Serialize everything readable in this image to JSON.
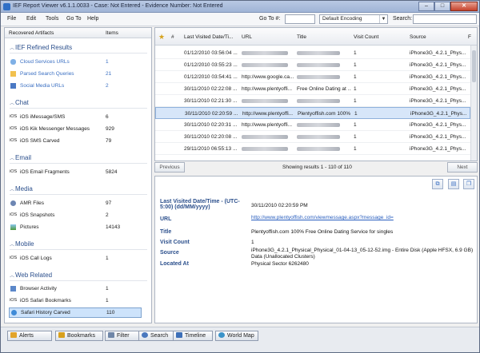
{
  "window": {
    "title": "IEF Report Viewer v6.1.1.0033 - Case: Not Entered - Evidence Number: Not Entered",
    "minimize": "–",
    "maximize": "□",
    "close": "✕"
  },
  "menubar": {
    "items": [
      "File",
      "Edit",
      "Tools",
      "Go To",
      "Help"
    ],
    "goto_label": "Go To #:",
    "goto_value": "",
    "encoding_value": "Default Encoding",
    "search_label": "Search:",
    "search_value": ""
  },
  "left_panel": {
    "header_artifacts": "Recovered Artifacts",
    "header_items": "Items",
    "sections": [
      {
        "title": "IEF Refined Results",
        "items": [
          {
            "label": "Cloud Services URLs",
            "count": "1",
            "icon": "cloud-icon",
            "link": true
          },
          {
            "label": "Parsed Search Queries",
            "count": "21",
            "icon": "search-query-icon",
            "link": true
          },
          {
            "label": "Social Media URLs",
            "count": "2",
            "icon": "social-icon",
            "link": true
          }
        ]
      },
      {
        "title": "Chat",
        "items": [
          {
            "label": "iOS iMessage/SMS",
            "count": "6",
            "icon": "ios-icon",
            "link": false
          },
          {
            "label": "iOS Kik Messenger Messages",
            "count": "929",
            "icon": "ios-icon",
            "link": false
          },
          {
            "label": "iOS SMS Carved",
            "count": "79",
            "icon": "ios-icon",
            "link": false
          }
        ]
      },
      {
        "title": "Email",
        "items": [
          {
            "label": "iOS Email Fragments",
            "count": "5824",
            "icon": "ios-icon",
            "link": false
          }
        ]
      },
      {
        "title": "Media",
        "items": [
          {
            "label": "AMR Files",
            "count": "97",
            "icon": "audio-icon",
            "link": false
          },
          {
            "label": "iOS Snapshots",
            "count": "2",
            "icon": "ios-icon",
            "link": false
          },
          {
            "label": "Pictures",
            "count": "14143",
            "icon": "picture-icon",
            "link": false
          }
        ]
      },
      {
        "title": "Mobile",
        "items": [
          {
            "label": "iOS Call Logs",
            "count": "1",
            "icon": "ios-icon",
            "link": false
          }
        ]
      },
      {
        "title": "Web Related",
        "items": [
          {
            "label": "Browser Activity",
            "count": "1",
            "icon": "browser-icon",
            "link": false
          },
          {
            "label": "iOS Safari Bookmarks",
            "count": "1",
            "icon": "ios-icon",
            "link": false
          },
          {
            "label": "Safari History Carved",
            "count": "110",
            "icon": "safari-icon",
            "link": false,
            "selected": true
          }
        ]
      }
    ]
  },
  "grid": {
    "headers": [
      "★",
      "#",
      "Last Visited Date/Ti...",
      "URL",
      "Title",
      "Visit Count",
      "Source"
    ],
    "rows": [
      {
        "date": "01/12/2010 03:56:04 ...",
        "url": "",
        "title": "",
        "visits": "1",
        "source": "iPhone3G_4.2.1_Phys..."
      },
      {
        "date": "01/12/2010 03:55:23 ...",
        "url": "",
        "title": "",
        "visits": "1",
        "source": "iPhone3G_4.2.1_Phys..."
      },
      {
        "date": "01/12/2010 03:54:41 ...",
        "url": "http://www.google.ca...",
        "title": "",
        "visits": "1",
        "source": "iPhone3G_4.2.1_Phys..."
      },
      {
        "date": "30/11/2010 02:22:08 ...",
        "url": "http://www.plentyoffi...",
        "title": "Free Online Dating at ...",
        "visits": "1",
        "source": "iPhone3G_4.2.1_Phys..."
      },
      {
        "date": "30/11/2010 02:21:30 ...",
        "url": "",
        "title": "",
        "visits": "1",
        "source": "iPhone3G_4.2.1_Phys..."
      },
      {
        "date": "30/11/2010 02:20:59 ...",
        "url": "http://www.plentyoffi...",
        "title": "Plentyoffish.com 100% ...",
        "visits": "1",
        "source": "iPhone3G_4.2.1_Phys...",
        "selected": true
      },
      {
        "date": "30/11/2010 02:20:31 ...",
        "url": "http://www.plentyoffi...",
        "title": "",
        "visits": "1",
        "source": "iPhone3G_4.2.1_Phys..."
      },
      {
        "date": "30/11/2010 02:20:08 ...",
        "url": "",
        "title": "",
        "visits": "1",
        "source": "iPhone3G_4.2.1_Phys..."
      },
      {
        "date": "29/11/2010 06:55:13 ...",
        "url": "",
        "title": "",
        "visits": "1",
        "source": "iPhone3G_4.2.1_Phys..."
      },
      {
        "date": "",
        "url": "",
        "title": "",
        "visits": "",
        "source": ""
      }
    ]
  },
  "pager": {
    "previous": "Previous",
    "info": "Showing results 1 - 110 of 110",
    "next": "Next"
  },
  "detail": {
    "fields": [
      {
        "key": "Last Visited Date/Time - (UTC-5:00) (dd/MM/yyyy)",
        "value": "30/11/2010 02:20:59 PM"
      },
      {
        "key": "URL",
        "value": "http://www.plentyoffish.com/viewmessage.aspx?message_id="
      },
      {
        "key": "Title",
        "value": "Plentyoffish.com 100% Free Online Dating Service for singles"
      },
      {
        "key": "Visit Count",
        "value": "1"
      },
      {
        "key": "Source",
        "value": "iPhone3G_4.2.1_Physical_Physical_01-04-13_05-12-52.img - Entire Disk (Apple HFSX, 6.9 GB) Data (Unallocated Clusters)"
      },
      {
        "key": "Located At",
        "value": "Physical Sector 6262480"
      }
    ]
  },
  "tabs": [
    "Alerts",
    "Bookmarks",
    "Filter",
    "Search",
    "Timeline",
    "World Map"
  ],
  "colors": {
    "accent": "#2b4f8c",
    "link": "#3a6fc2",
    "selection": "#d7e6f9"
  }
}
